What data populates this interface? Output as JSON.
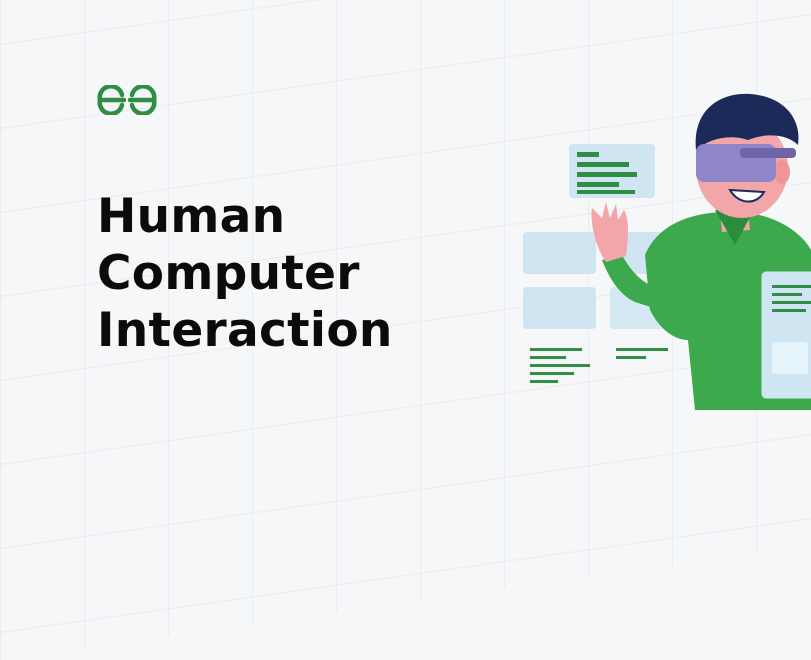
{
  "brand": {
    "logo_icon": "gfg-logo-icon",
    "accent": "#2f8d46"
  },
  "title": {
    "line1": "Human",
    "line2": "Computer",
    "line3": "Interaction"
  },
  "illustration": {
    "icon": "vr-headset-person-illustration"
  },
  "colors": {
    "background": "#f6f7f9",
    "text": "#0b0b0b",
    "shirt": "#3caa4c",
    "panel": "#cfe6f2",
    "hair": "#1c2a5a"
  }
}
